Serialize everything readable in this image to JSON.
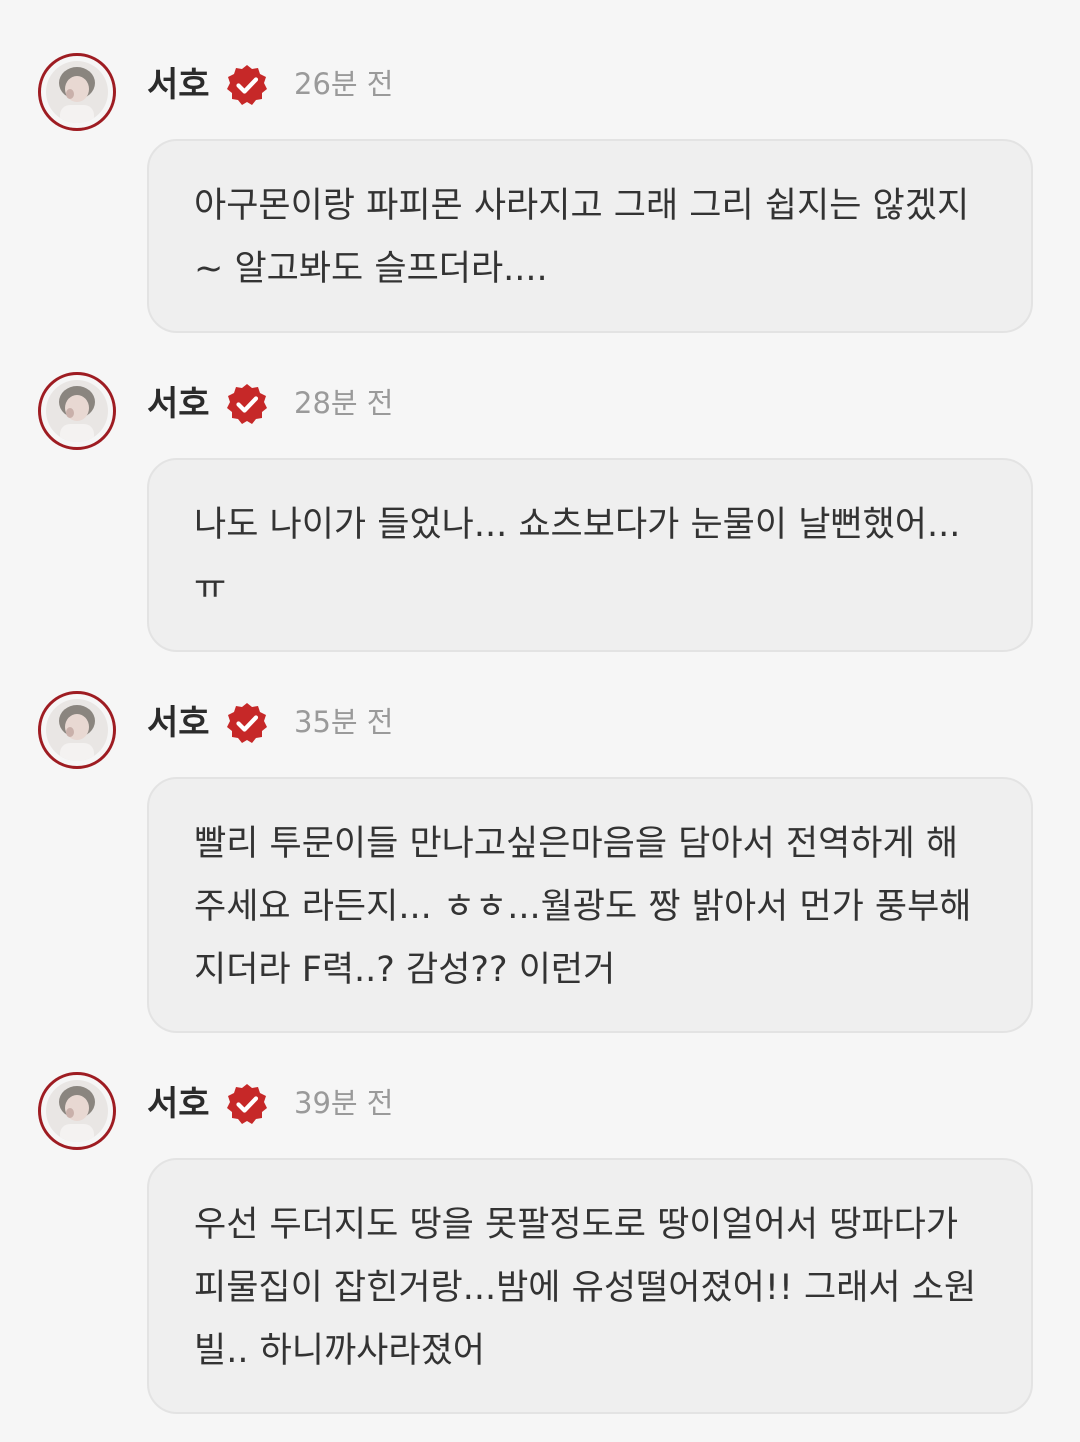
{
  "colors": {
    "page_background": "#f6f6f6",
    "bubble_background": "#efefef",
    "verified_badge": "#c62828",
    "avatar_ring": "#9e1c22",
    "timestamp": "#9a9a9a",
    "text": "#333333"
  },
  "posts": [
    {
      "author": "서호",
      "verified_icon": "verified-badge-icon",
      "time": "26분 전",
      "message": "아구몬이랑 파피몬 사라지고 그래 그리 쉽지는 않겠지~ 알고봐도 슬프더라...."
    },
    {
      "author": "서호",
      "verified_icon": "verified-badge-icon",
      "time": "28분 전",
      "message": "나도 나이가 들었나... 쇼츠보다가 눈물이 날뻔했어...ㅠ"
    },
    {
      "author": "서호",
      "verified_icon": "verified-badge-icon",
      "time": "35분 전",
      "message": "빨리 투문이들 만나고싶은마음을 담아서 전역하게 해주세요 라든지... ㅎㅎ...월광도 짱 밝아서 먼가 풍부해지더라 F력..? 감성?? 이런거"
    },
    {
      "author": "서호",
      "verified_icon": "verified-badge-icon",
      "time": "39분 전",
      "message": "우선 두더지도 땅을 못팔정도로 땅이얼어서 땅파다가 피물집이 잡힌거랑...밤에 유성떨어졌어!! 그래서 소원 빌.. 하니까사라졌어"
    }
  ]
}
